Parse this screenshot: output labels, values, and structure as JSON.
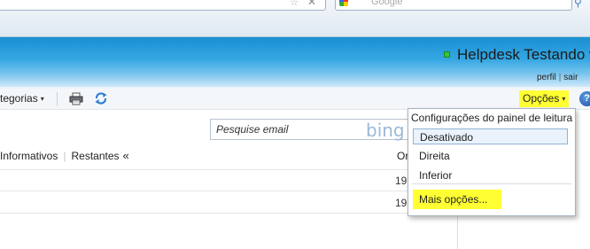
{
  "browser": {
    "search_engine_text": "Google",
    "star_glyph": "☆",
    "close_glyph": "✕"
  },
  "header": {
    "user_name": "Helpdesk Testando v",
    "profile_link": "perfil",
    "links_separator": "|",
    "signout_link": "sair",
    "presence_color": "#35c43a"
  },
  "toolbar": {
    "categories_label": "tegorias",
    "caret": "▾",
    "options_label": "Opções",
    "help_glyph": "?"
  },
  "search": {
    "placeholder": "Pesquise email",
    "logo_text": "bing"
  },
  "filters": {
    "items": [
      "Informativos",
      "Restantes"
    ],
    "separator": "|",
    "collapse_glyph": "«"
  },
  "list": {
    "date_column": "Or",
    "rows": [
      {
        "date": "19."
      },
      {
        "date": "19."
      }
    ]
  },
  "options_menu": {
    "header": "Configurações do painel de leitura",
    "items": [
      "Desativado",
      "Direita",
      "Inferior"
    ],
    "selected": "Desativado",
    "more_label": "Mais opções...",
    "highlight_color": "#ffff33"
  }
}
